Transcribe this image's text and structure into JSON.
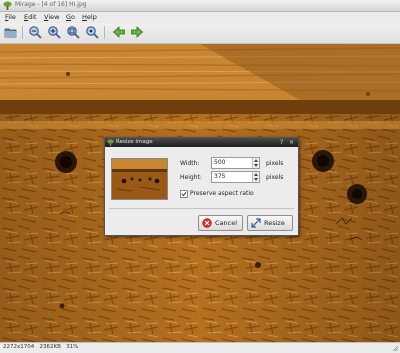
{
  "window": {
    "title": "Mirage - [4 of 16] HI.jpg"
  },
  "menubar": {
    "items": [
      "File",
      "Edit",
      "View",
      "Go",
      "Help"
    ]
  },
  "toolbar": {
    "buttons": [
      "open-folder",
      "zoom-out",
      "zoom-in",
      "zoom-fit",
      "zoom-100",
      "go-previous",
      "go-next"
    ]
  },
  "status": {
    "dimensions": "2272x1704",
    "filesize": "2362KB",
    "zoom": "31%"
  },
  "dialog": {
    "title": "Resize Image",
    "width_label": "Width:",
    "width_value": "500",
    "width_unit": "pixels",
    "height_label": "Height:",
    "height_value": "375",
    "height_unit": "pixels",
    "aspect_label": "Preserve aspect ratio",
    "aspect_checked": true,
    "cancel_label": "Cancel",
    "resize_label": "Resize"
  },
  "colors": {
    "wood": "#b06a18",
    "beam": "#cf8a32",
    "dialog_bg": "#ececec",
    "titlebar_dark": "#2a2a2a"
  }
}
